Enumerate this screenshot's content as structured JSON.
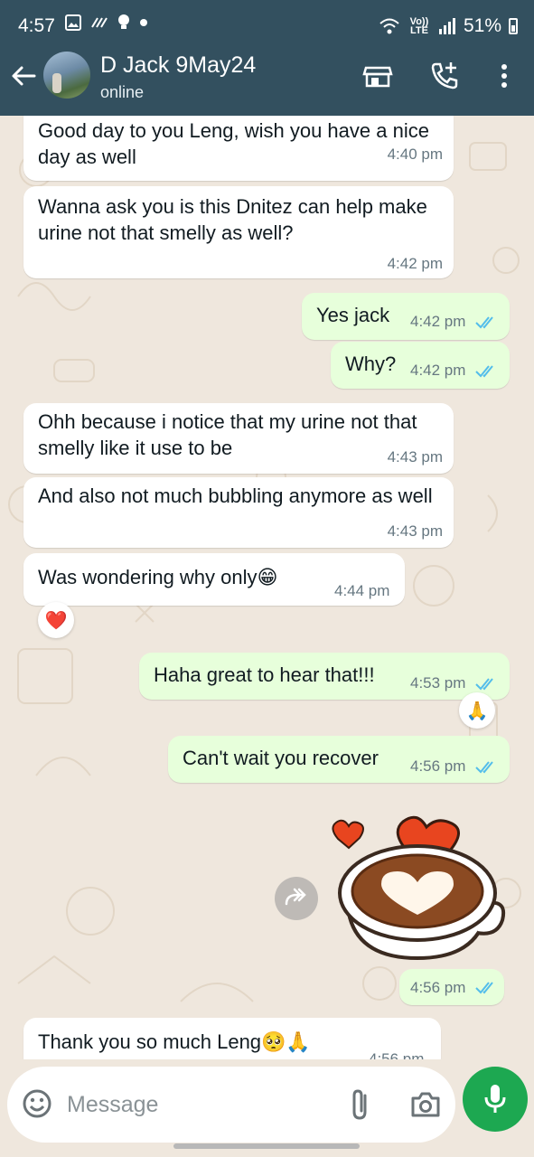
{
  "status_bar": {
    "time": "4:57",
    "volte": "Vo)) LTE",
    "battery": "51%"
  },
  "header": {
    "contact_name": "D Jack 9May24",
    "presence": "online"
  },
  "messages": [
    {
      "dir": "in",
      "text": "Good day to you Leng, wish you have a nice day as well",
      "time": "4:40 pm"
    },
    {
      "dir": "in",
      "text": "Wanna ask you is this Dnitez can help make urine not that smelly as well?",
      "time": "4:42 pm"
    },
    {
      "dir": "out",
      "text": "Yes jack",
      "time": "4:42 pm"
    },
    {
      "dir": "out",
      "text": "Why?",
      "time": "4:42 pm"
    },
    {
      "dir": "in",
      "text": "Ohh because i notice that my urine not that smelly like it use to be",
      "time": "4:43 pm"
    },
    {
      "dir": "in",
      "text": "And also not much bubbling anymore as well",
      "time": "4:43 pm"
    },
    {
      "dir": "in",
      "text": "Was wondering why only😁",
      "time": "4:44 pm",
      "reaction": "❤️"
    },
    {
      "dir": "out",
      "text": "Haha great to hear that!!!",
      "time": "4:53 pm",
      "reaction": "🙏"
    },
    {
      "dir": "out",
      "text": "Can't wait you recover",
      "time": "4:56 pm"
    },
    {
      "dir": "out",
      "text": "",
      "time": "4:56 pm",
      "sticker": "coffee-heart-sticker"
    },
    {
      "dir": "in",
      "text": "Thank you so much Leng🥺🙏",
      "time": "4:56 pm"
    }
  ],
  "composer": {
    "placeholder": "Message"
  },
  "colors": {
    "header": "#33505f",
    "outgoing": "#e7ffdb",
    "incoming": "#ffffff",
    "read_ticks": "#53bdeb",
    "mic": "#1da851"
  },
  "icons": [
    "back-arrow-icon",
    "store-icon",
    "add-call-icon",
    "more-icon",
    "emoji-icon",
    "attach-icon",
    "camera-icon",
    "mic-icon",
    "forward-icon"
  ]
}
